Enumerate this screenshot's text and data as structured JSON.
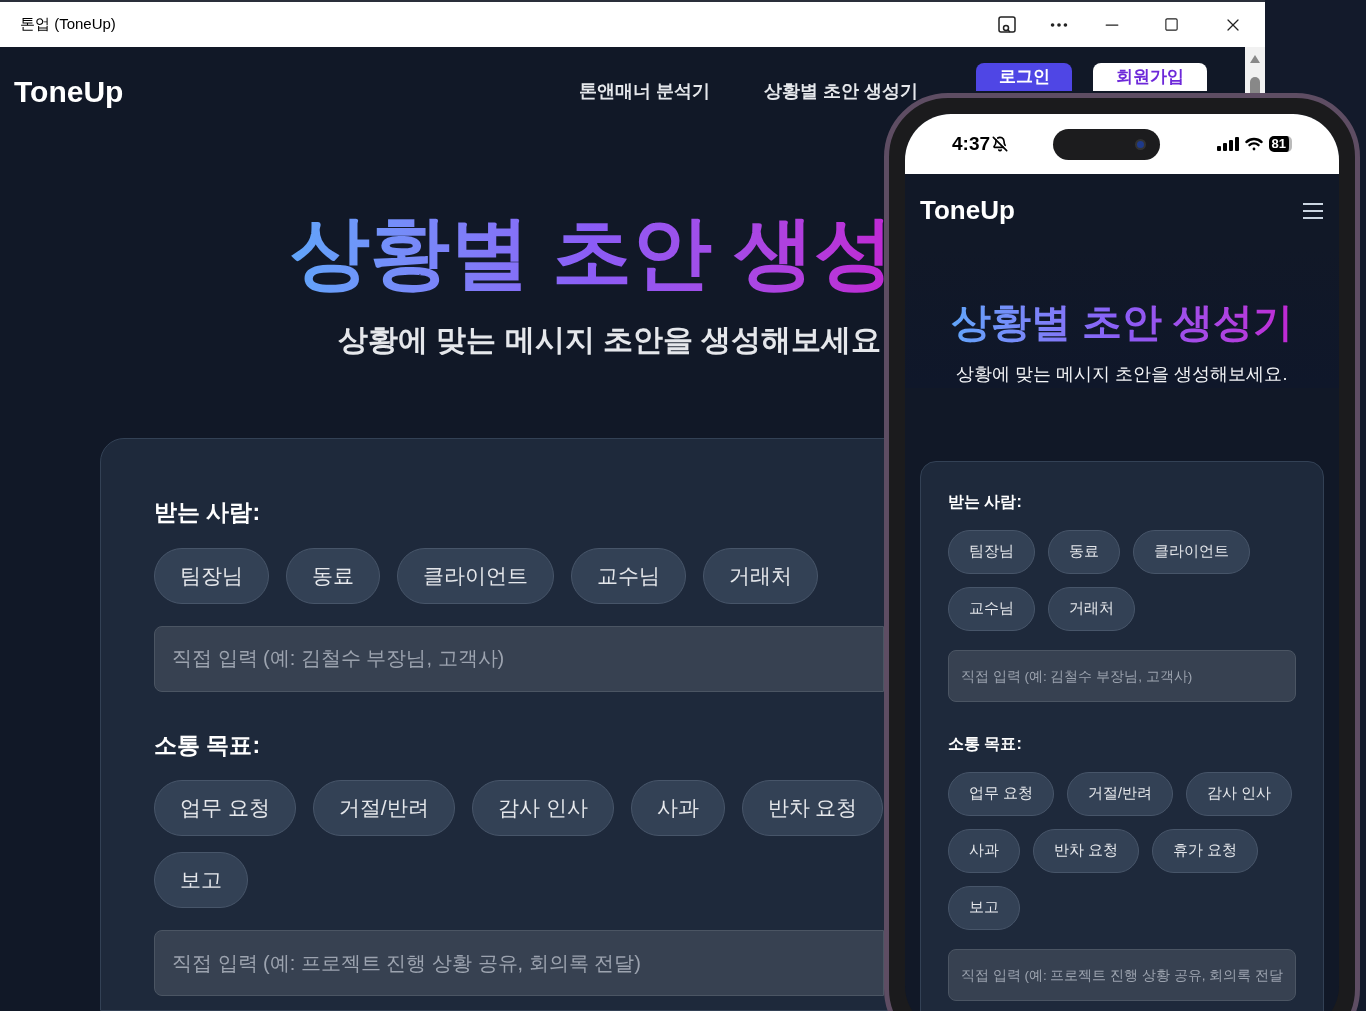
{
  "browser": {
    "title": "톤업 (ToneUp)"
  },
  "desktop": {
    "logo": "ToneUp",
    "nav": [
      {
        "label": "톤앤매너 분석기"
      },
      {
        "label": "상황별 초안 생성기"
      }
    ],
    "login": "로그인",
    "signup": "회원가입",
    "heading": "상황별 초안 생성",
    "subtitle": "상황에 맞는 메시지 초안을 생성해보세요",
    "sections": [
      {
        "label": "받는 사람:",
        "chips": [
          "팀장님",
          "동료",
          "클라이언트",
          "교수님",
          "거래처"
        ],
        "placeholder": "직접 입력 (예: 김철수 부장님, 고객사)"
      },
      {
        "label": "소통 목표:",
        "chips": [
          "업무 요청",
          "거절/반려",
          "감사 인사",
          "사과",
          "반차 요청",
          "보고"
        ],
        "placeholder": "직접 입력 (예: 프로젝트 진행 상황 공유, 회의록 전달)"
      }
    ]
  },
  "phone": {
    "status": {
      "time": "4:37",
      "battery": "81"
    },
    "logo": "ToneUp",
    "heading": "상황별 초안 생성기",
    "subtitle": "상황에 맞는 메시지 초안을 생성해보세요.",
    "sections": [
      {
        "label": "받는 사람:",
        "chips": [
          "팀장님",
          "동료",
          "클라이언트",
          "교수님",
          "거래처"
        ],
        "placeholder": "직접 입력 (예: 김철수 부장님, 고객사)"
      },
      {
        "label": "소통 목표:",
        "chips": [
          "업무 요청",
          "거절/반려",
          "감사 인사",
          "사과",
          "반차 요청",
          "휴가 요청",
          "보고"
        ],
        "placeholder": "직접 입력 (예: 프로젝트 진행 상황 공유, 회의록 전달"
      }
    ]
  }
}
